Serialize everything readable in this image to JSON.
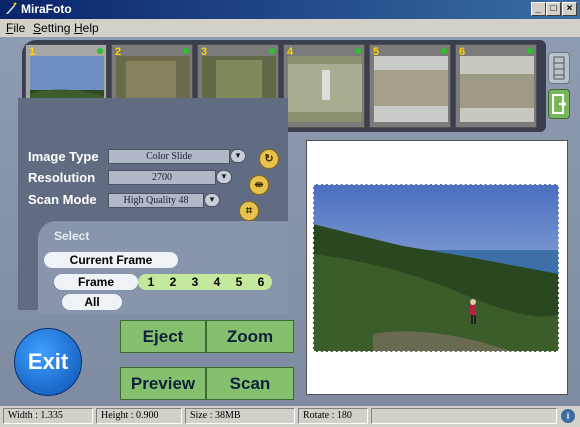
{
  "window": {
    "title": "MiraFoto"
  },
  "menu": {
    "items": [
      {
        "label": "ile",
        "accel": "F"
      },
      {
        "label": "etting",
        "accel": "S"
      },
      {
        "label": "elp",
        "accel": "H"
      }
    ]
  },
  "filmstrip": {
    "frames": [
      {
        "number": "1"
      },
      {
        "number": "2"
      },
      {
        "number": "3"
      },
      {
        "number": "4"
      },
      {
        "number": "5"
      },
      {
        "number": "6"
      }
    ]
  },
  "settings": {
    "image_type_label": "Image Type",
    "image_type_value": "Color Slide",
    "resolution_label": "Resolution",
    "resolution_value": "2700",
    "scan_mode_label": "Scan Mode",
    "scan_mode_value": "High Quality 48"
  },
  "select": {
    "title": "Select",
    "current_frame": "Current Frame",
    "frame": "Frame",
    "all": "All",
    "frame_numbers": [
      "1",
      "2",
      "3",
      "4",
      "5",
      "6"
    ]
  },
  "buttons": {
    "eject": "Eject",
    "zoom": "Zoom",
    "preview": "Preview",
    "scan": "Scan",
    "exit": "Exit"
  },
  "status": {
    "width": "Width : 1.335",
    "height": "Height : 0.900",
    "size": "Size : 38MB",
    "rotate": "Rotate : 180"
  },
  "colors": {
    "accent": "#84c06e",
    "exit": "#0a4fb0",
    "titlebar": "#0a246a"
  }
}
